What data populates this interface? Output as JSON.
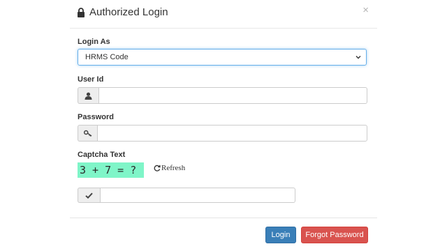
{
  "dialog": {
    "title": "Authorized Login",
    "close_symbol": "×"
  },
  "form": {
    "login_as": {
      "label": "Login As",
      "selected": "HRMS Code"
    },
    "user_id": {
      "label": "User Id",
      "value": ""
    },
    "password": {
      "label": "Password",
      "value": ""
    },
    "captcha": {
      "label": "Captcha Text",
      "text": "3 + 7 = ?",
      "refresh_label": "Refresh",
      "answer": ""
    }
  },
  "buttons": {
    "login": "Login",
    "forgot_password": "Forgot Password"
  },
  "icons": {
    "title": "lock-icon",
    "user": "user-icon",
    "password": "key-icon",
    "captcha_answer": "check-icon",
    "refresh": "refresh-icon"
  },
  "colors": {
    "primary": "#3a7fb8",
    "danger": "#d9534f",
    "captcha_bg": "#7ff5c8",
    "focus": "#66afe9"
  }
}
